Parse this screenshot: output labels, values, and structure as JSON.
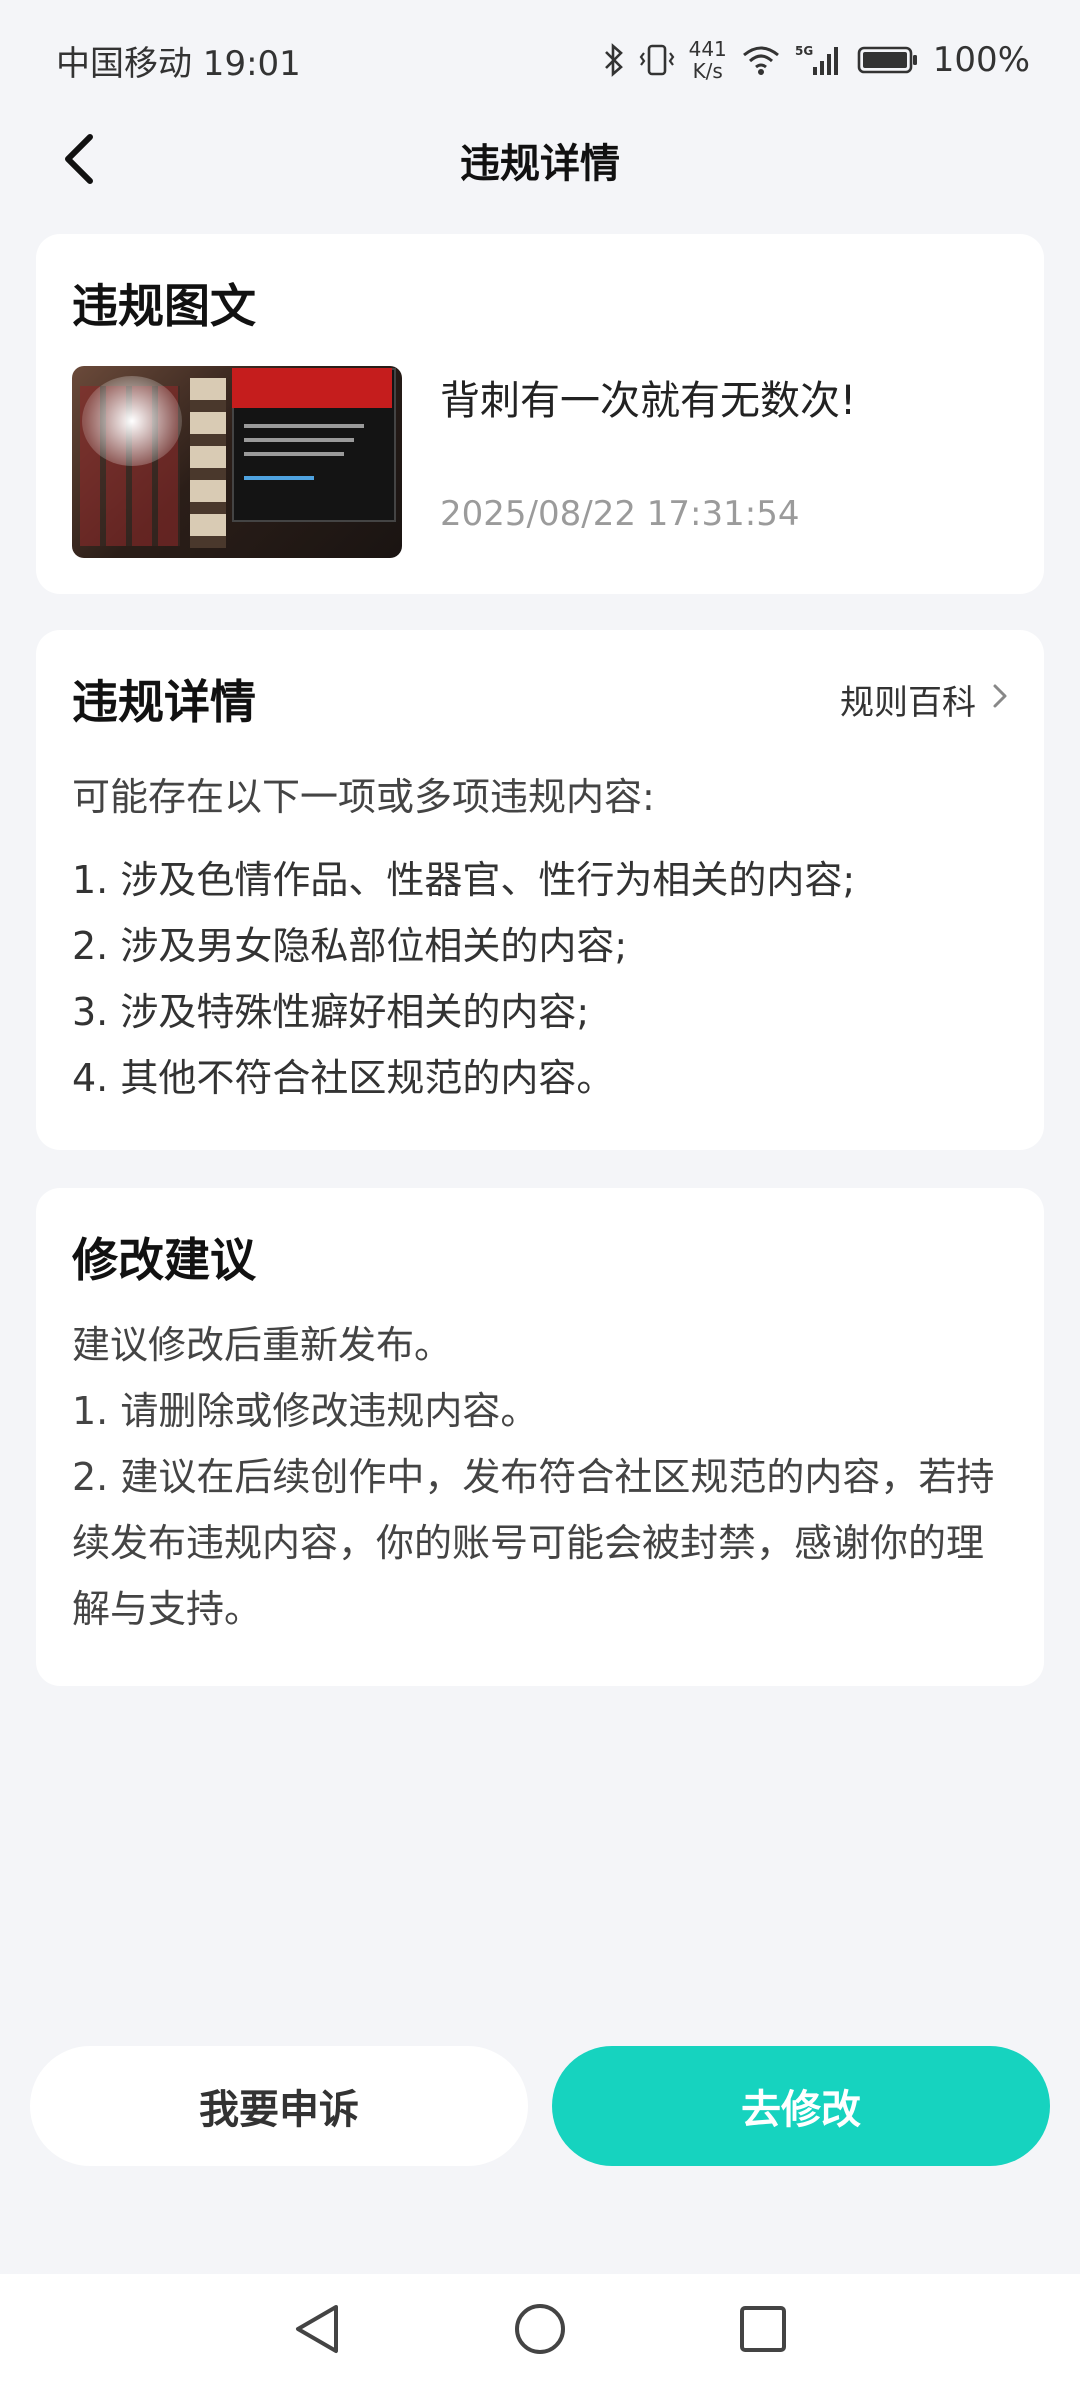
{
  "status_bar": {
    "carrier_time": "中国移动 19:01",
    "net_speed_value": "441",
    "net_speed_unit": "K/s",
    "network_type": "5G",
    "battery": "100%"
  },
  "header": {
    "title": "违规详情"
  },
  "post_card": {
    "title": "违规图文",
    "post_text": "背刺有一次就有无数次!",
    "post_time": "2025/08/22 17:31:54"
  },
  "violation_card": {
    "title": "违规详情",
    "rules_link": "规则百科",
    "intro": "可能存在以下一项或多项违规内容:",
    "items": [
      "1. 涉及色情作品、性器官、性行为相关的内容;",
      "2. 涉及男女隐私部位相关的内容;",
      "3. 涉及特殊性癖好相关的内容;",
      "4. 其他不符合社区规范的内容。"
    ]
  },
  "suggestion_card": {
    "title": "修改建议",
    "lines": [
      "建议修改后重新发布。",
      "1. 请删除或修改违规内容。",
      "2. 建议在后续创作中，发布符合社区规范的内容，若持续发布违规内容，你的账号可能会被封禁，感谢你的理解与支持。"
    ]
  },
  "actions": {
    "appeal_label": "我要申诉",
    "edit_label": "去修改"
  },
  "colors": {
    "accent": "#16d3bf",
    "background": "#f4f5f8",
    "card": "#ffffff"
  },
  "icons": {
    "back": "back-arrow-icon",
    "rules_chevron": "chevron-right-icon",
    "nav": [
      "nav-back-icon",
      "nav-home-icon",
      "nav-recents-icon"
    ]
  }
}
